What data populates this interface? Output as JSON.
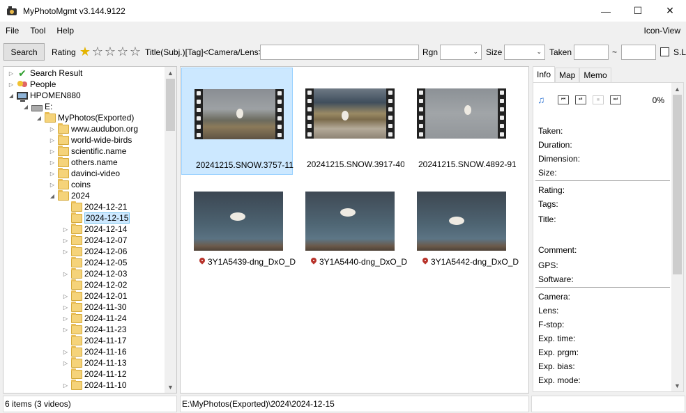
{
  "window": {
    "title": "MyPhotoMgmt v3.144.9122",
    "minimize": "—",
    "maximize": "☐",
    "close": "✕"
  },
  "menu": {
    "items": [
      "File",
      "Tool",
      "Help"
    ],
    "view_mode": "Icon-View"
  },
  "toolbar": {
    "search_label": "Search",
    "rating_label": "Rating",
    "rating_value": 1,
    "rating_max": 5,
    "title_label": "Title(Subj.)[Tag]<Camera/Lens>",
    "title_value": "",
    "rgn_label": "Rgn",
    "rgn_value": "",
    "size_label": "Size",
    "size_value": "",
    "taken_label": "Taken",
    "taken_from": "",
    "taken_sep": "~",
    "taken_to": "",
    "sl_label": "S.L",
    "sl_checked": false
  },
  "tree": {
    "items": [
      {
        "label": "Search Result",
        "icon": "check-icon",
        "level": 0,
        "expander": "▷"
      },
      {
        "label": "People",
        "icon": "people-icon",
        "level": 0,
        "expander": "▷"
      },
      {
        "label": "HPOMEN880",
        "icon": "computer-icon",
        "level": 0,
        "expander": "◢"
      },
      {
        "label": "E:",
        "icon": "drive-icon",
        "level": 1,
        "expander": "◢"
      },
      {
        "label": "MyPhotos(Exported)",
        "icon": "folder-icon",
        "level": 2,
        "expander": "◢"
      },
      {
        "label": "www.audubon.org",
        "icon": "folder-icon",
        "level": 3,
        "expander": "▷"
      },
      {
        "label": "world-wide-birds",
        "icon": "folder-icon",
        "level": 3,
        "expander": "▷"
      },
      {
        "label": "scientific.name",
        "icon": "folder-icon",
        "level": 3,
        "expander": "▷"
      },
      {
        "label": "others.name",
        "icon": "folder-icon",
        "level": 3,
        "expander": "▷"
      },
      {
        "label": "davinci-video",
        "icon": "folder-icon",
        "level": 3,
        "expander": "▷"
      },
      {
        "label": "coins",
        "icon": "folder-icon",
        "level": 3,
        "expander": "▷"
      },
      {
        "label": "2024",
        "icon": "folder-icon",
        "level": 3,
        "expander": "◢"
      },
      {
        "label": "2024-12-21",
        "icon": "folder-icon",
        "level": 4,
        "expander": ""
      },
      {
        "label": "2024-12-15",
        "icon": "folder-icon",
        "level": 4,
        "expander": "",
        "selected": true
      },
      {
        "label": "2024-12-14",
        "icon": "folder-icon",
        "level": 4,
        "expander": "▷"
      },
      {
        "label": "2024-12-07",
        "icon": "folder-icon",
        "level": 4,
        "expander": "▷"
      },
      {
        "label": "2024-12-06",
        "icon": "folder-icon",
        "level": 4,
        "expander": "▷"
      },
      {
        "label": "2024-12-05",
        "icon": "folder-icon",
        "level": 4,
        "expander": ""
      },
      {
        "label": "2024-12-03",
        "icon": "folder-icon",
        "level": 4,
        "expander": "▷"
      },
      {
        "label": "2024-12-02",
        "icon": "folder-icon",
        "level": 4,
        "expander": ""
      },
      {
        "label": "2024-12-01",
        "icon": "folder-icon",
        "level": 4,
        "expander": "▷"
      },
      {
        "label": "2024-11-30",
        "icon": "folder-icon",
        "level": 4,
        "expander": "▷"
      },
      {
        "label": "2024-11-24",
        "icon": "folder-icon",
        "level": 4,
        "expander": "▷"
      },
      {
        "label": "2024-11-23",
        "icon": "folder-icon",
        "level": 4,
        "expander": "▷"
      },
      {
        "label": "2024-11-17",
        "icon": "folder-icon",
        "level": 4,
        "expander": ""
      },
      {
        "label": "2024-11-16",
        "icon": "folder-icon",
        "level": 4,
        "expander": "▷"
      },
      {
        "label": "2024-11-13",
        "icon": "folder-icon",
        "level": 4,
        "expander": "▷"
      },
      {
        "label": "2024-11-12",
        "icon": "folder-icon",
        "level": 4,
        "expander": ""
      },
      {
        "label": "2024-11-10",
        "icon": "folder-icon",
        "level": 4,
        "expander": "▷"
      }
    ]
  },
  "thumbnails": [
    {
      "name": "20241215.SNOW.3757-11",
      "kind": "video",
      "geotag": false,
      "selected": true,
      "scene": "owl-on-grass"
    },
    {
      "name": "20241215.SNOW.3917-40",
      "kind": "video",
      "geotag": false,
      "selected": false,
      "scene": "owl-on-rocks"
    },
    {
      "name": "20241215.SNOW.4892-91",
      "kind": "video",
      "geotag": false,
      "selected": false,
      "scene": "owl-on-branch"
    },
    {
      "name": "3Y1A5439-dng_DxO_D",
      "kind": "photo",
      "geotag": true,
      "selected": false,
      "scene": "owl-flying-1"
    },
    {
      "name": "3Y1A5440-dng_DxO_D",
      "kind": "photo",
      "geotag": true,
      "selected": false,
      "scene": "owl-flying-2"
    },
    {
      "name": "3Y1A5442-dng_DxO_D",
      "kind": "photo",
      "geotag": true,
      "selected": false,
      "scene": "owl-flying-3"
    }
  ],
  "info": {
    "tabs": [
      "Info",
      "Map",
      "Memo"
    ],
    "active_tab": "Info",
    "progress": "0%",
    "media_icons": [
      "music-note-icon",
      "prev-icon",
      "play-pause-icon",
      "stop-icon",
      "next-icon"
    ],
    "fields_group1": [
      "Taken:",
      "Duration:",
      "Dimension:",
      "Size:"
    ],
    "fields_group2": [
      "Rating:",
      "Tags:",
      "Title:",
      "Comment:",
      "GPS:",
      "Software:"
    ],
    "fields_group3": [
      "Camera:",
      "Lens:",
      "F-stop:",
      "Exp. time:",
      "Exp. prgm:",
      "Exp. bias:",
      "Exp. mode:"
    ]
  },
  "status": {
    "count": "6 items (3 videos)",
    "path": "E:\\MyPhotos(Exported)\\2024\\2024-12-15",
    "right": ""
  },
  "colors": {
    "selection": "#cce8ff",
    "star_on": "#e4b400",
    "pin": "#b8322a"
  }
}
